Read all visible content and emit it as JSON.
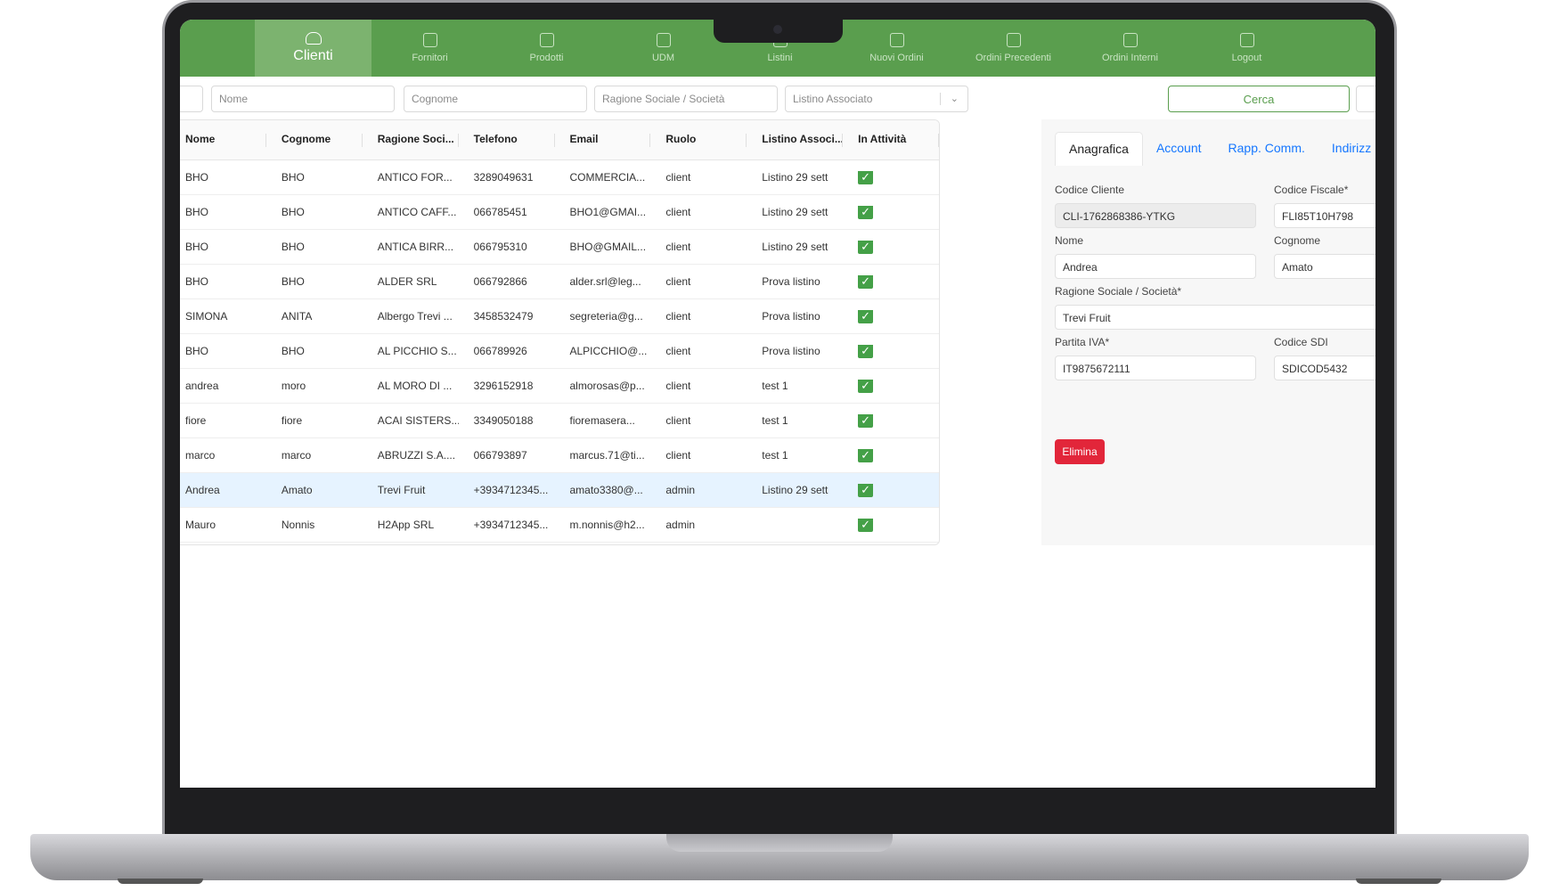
{
  "nav": {
    "items": [
      {
        "label": "Clienti",
        "icon": "users-icon"
      },
      {
        "label": "Fornitori",
        "icon": "truck-icon"
      },
      {
        "label": "Prodotti",
        "icon": "box-icon"
      },
      {
        "label": "UDM",
        "icon": "basket-icon"
      },
      {
        "label": "Listini",
        "icon": "list-icon"
      },
      {
        "label": "Nuovi Ordini",
        "icon": "document-icon"
      },
      {
        "label": "Ordini Precedenti",
        "icon": "document-icon"
      },
      {
        "label": "Ordini Interni",
        "icon": "document-icon"
      },
      {
        "label": "Logout",
        "icon": "logout-icon"
      }
    ],
    "active": "Clienti",
    "color": "#5a9e4e"
  },
  "filters": {
    "nome_placeholder": "Nome",
    "cognome_placeholder": "Cognome",
    "ragione_placeholder": "Ragione Sociale / Società",
    "listino_placeholder": "Listino Associato",
    "search_label": "Cerca"
  },
  "table": {
    "headers": [
      "Nome",
      "Cognome",
      "Ragione Soci...",
      "Telefono",
      "Email",
      "Ruolo",
      "Listino Associ...",
      "In Attività"
    ],
    "rows": [
      [
        "BHO",
        "BHO",
        "ANTICO FOR...",
        "3289049631",
        "COMMERCIA...",
        "client",
        "Listino 29 sett"
      ],
      [
        "BHO",
        "BHO",
        "ANTICO CAFF...",
        "066785451",
        "BHO1@GMAI...",
        "client",
        "Listino 29 sett"
      ],
      [
        "BHO",
        "BHO",
        "ANTICA BIRR...",
        "066795310",
        "BHO@GMAIL...",
        "client",
        "Listino 29 sett"
      ],
      [
        "BHO",
        "BHO",
        "ALDER SRL",
        "066792866",
        "alder.srl@leg...",
        "client",
        "Prova listino"
      ],
      [
        "SIMONA",
        "ANITA",
        "Albergo Trevi ...",
        "3458532479",
        "segreteria@g...",
        "client",
        "Prova listino"
      ],
      [
        "BHO",
        "BHO",
        "AL PICCHIO S...",
        "066789926",
        "ALPICCHIO@...",
        "client",
        "Prova listino"
      ],
      [
        "andrea",
        "moro",
        "AL MORO DI ...",
        "3296152918",
        "almorosas@p...",
        "client",
        "test 1"
      ],
      [
        "fiore",
        "fiore",
        "ACAI SISTERS...",
        "3349050188",
        "fioremasera...",
        "client",
        "test 1"
      ],
      [
        "marco",
        "marco",
        "ABRUZZI S.A....",
        "066793897",
        "marcus.71@ti...",
        "client",
        "test 1"
      ],
      [
        "Andrea",
        "Amato",
        "Trevi Fruit",
        "+3934712345...",
        "amato3380@...",
        "admin",
        "Listino 29 sett"
      ],
      [
        "Mauro",
        "Nonnis",
        "H2App SRL",
        "+3934712345...",
        "m.nonnis@h2...",
        "admin",
        ""
      ]
    ],
    "active": [
      true,
      true,
      true,
      true,
      true,
      true,
      true,
      true,
      true,
      true,
      true
    ],
    "selected_row": 9,
    "check_mark": "✓"
  },
  "panel": {
    "tabs": [
      "Anagrafica",
      "Account",
      "Rapp. Comm.",
      "Indirizz"
    ],
    "active_tab": "Anagrafica",
    "fields": {
      "codice_cliente_label": "Codice Cliente",
      "codice_cliente_value": "CLI-1762868386-YTKG",
      "codice_fiscale_label": "Codice Fiscale*",
      "codice_fiscale_value": "FLI85T10H798",
      "nome_label": "Nome",
      "nome_value": "Andrea",
      "cognome_label": "Cognome",
      "cognome_value": "Amato",
      "ragione_label": "Ragione Sociale / Società*",
      "ragione_value": "Trevi Fruit",
      "piva_label": "Partita IVA*",
      "piva_value": "IT9875672111",
      "sdi_label": "Codice SDI",
      "sdi_value": "SDICOD5432"
    },
    "delete_label": "Elimina"
  }
}
